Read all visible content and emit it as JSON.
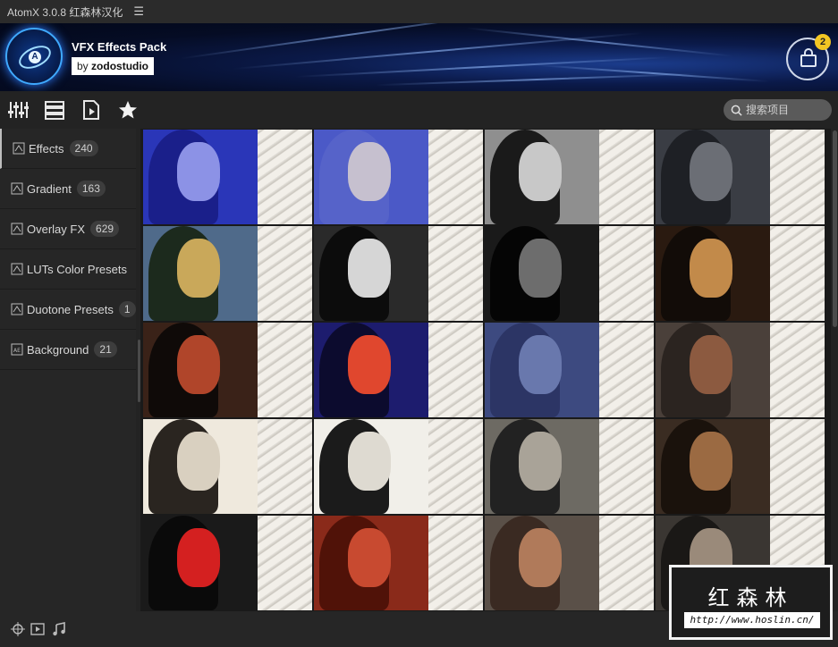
{
  "titlebar": {
    "title": "AtomX  3.0.8 红森林汉化",
    "menu_icon": "hamburger-icon"
  },
  "banner": {
    "pack_title": "VFX Effects Pack",
    "by": "by",
    "author": "zodostudio",
    "cart_count": "2"
  },
  "toolbar": {
    "search_placeholder": "搜索项目"
  },
  "sidebar": {
    "items": [
      {
        "label": "Effects",
        "count": "240"
      },
      {
        "label": "Gradient",
        "count": "163"
      },
      {
        "label": "Overlay FX",
        "count": "629"
      },
      {
        "label": "LUTs Color Presets",
        "count": ""
      },
      {
        "label": "Duotone Presets",
        "count": "1"
      },
      {
        "label": "Background",
        "count": "21"
      }
    ]
  },
  "thumbnails": [
    {
      "tone": "#2a36b8",
      "hair": "#1a1f8a",
      "face": "#8c92e6"
    },
    {
      "tone": "#4b59c7",
      "hair": "#5663c9",
      "face": "#c6c0cf"
    },
    {
      "tone": "#8f8f8f",
      "hair": "#1a1a1a",
      "face": "#c8c8c8"
    },
    {
      "tone": "#3a3d44",
      "hair": "#1e2025",
      "face": "#6b6e75"
    },
    {
      "tone": "#4f6a8a",
      "hair": "#1c2a1d",
      "face": "#c9a85a"
    },
    {
      "tone": "#2a2a2a",
      "hair": "#0c0c0c",
      "face": "#d6d6d6"
    },
    {
      "tone": "#1a1a1a",
      "hair": "#050505",
      "face": "#6d6d6d"
    },
    {
      "tone": "#2a1a10",
      "hair": "#120c08",
      "face": "#c28a4a"
    },
    {
      "tone": "#3a2218",
      "hair": "#0f0a08",
      "face": "#b0452a"
    },
    {
      "tone": "#1d1c6e",
      "hair": "#0c0b2e",
      "face": "#e0472e"
    },
    {
      "tone": "#3d4a80",
      "hair": "#2c3565",
      "face": "#6978ad"
    },
    {
      "tone": "#4a403a",
      "hair": "#2b2420",
      "face": "#8c5a40"
    },
    {
      "tone": "#efe9dd",
      "hair": "#2a2520",
      "face": "#d9d0c0"
    },
    {
      "tone": "#f1efe9",
      "hair": "#1b1b1b",
      "face": "#dedad1"
    },
    {
      "tone": "#6d6a63",
      "hair": "#222",
      "face": "#a9a398"
    },
    {
      "tone": "#3a2c22",
      "hair": "#1a120c",
      "face": "#9b6a42"
    },
    {
      "tone": "#1a1a1a",
      "hair": "#0a0a0a",
      "face": "#d42020"
    },
    {
      "tone": "#8a2a1a",
      "hair": "#501208",
      "face": "#c84a30"
    },
    {
      "tone": "#5a5048",
      "hair": "#3a2a22",
      "face": "#b07a5a"
    },
    {
      "tone": "#3a3632",
      "hair": "#1a1816",
      "face": "#9a8a7a"
    }
  ],
  "watermark": {
    "title": "红森林",
    "url": "http://www.hoslin.cn/"
  }
}
